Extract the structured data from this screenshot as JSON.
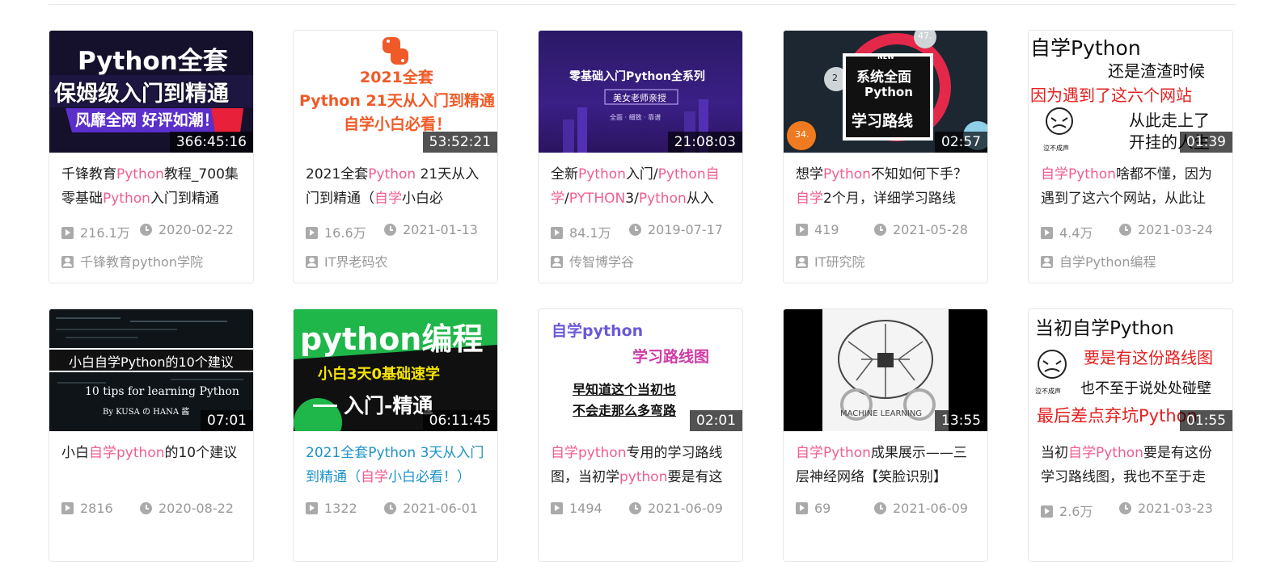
{
  "cards": [
    {
      "thumb": {
        "lines": [
          "Python全套",
          "保姆级入门到精通",
          "风靡全网  好评如潮！"
        ]
      },
      "duration": "366:45:16",
      "title": [
        {
          "t": "千锋教育"
        },
        {
          "t": "Python",
          "hl": true
        },
        {
          "t": "教程_700集零基础"
        },
        {
          "t": "Python",
          "hl": true
        },
        {
          "t": "入门到精通"
        }
      ],
      "views": "216.1万",
      "date": "2020-02-22",
      "author": "千锋教育python学院"
    },
    {
      "thumb": {
        "lines": [
          "2021全套",
          "Python 21天从入门到精通",
          "自学小白必看！"
        ]
      },
      "duration": "53:52:21",
      "title": [
        {
          "t": "2021全套"
        },
        {
          "t": "Python",
          "hl": true
        },
        {
          "t": " 21天从入门到精通（"
        },
        {
          "t": "自学",
          "hl": true
        },
        {
          "t": "小白必"
        }
      ],
      "views": "16.6万",
      "date": "2021-01-13",
      "author": "IT界老码农"
    },
    {
      "thumb": {
        "lines": [
          "零基础入门Python全系列",
          "美女老师亲授",
          "全面  ·  细致  ·  靠谱"
        ]
      },
      "duration": "21:08:03",
      "title": [
        {
          "t": "全新"
        },
        {
          "t": "Python",
          "hl": true
        },
        {
          "t": "入门/"
        },
        {
          "t": "Python自学",
          "hl": true
        },
        {
          "t": "/"
        },
        {
          "t": "PYTHON",
          "hl": true
        },
        {
          "t": "3/"
        },
        {
          "t": "Python",
          "hl": true
        },
        {
          "t": "从入"
        }
      ],
      "views": "84.1万",
      "date": "2019-07-17",
      "author": "传智博学谷"
    },
    {
      "thumb": {
        "lines": [
          "NEW",
          "系统全面",
          "Python",
          "学习路线",
          "47.",
          "2",
          "34."
        ]
      },
      "duration": "02:57",
      "title": [
        {
          "t": "想学"
        },
        {
          "t": "Python",
          "hl": true
        },
        {
          "t": "不知如何下手？"
        },
        {
          "t": "自学",
          "hl": true
        },
        {
          "t": "2个月，详细学习路线"
        }
      ],
      "views": "419",
      "date": "2021-05-28",
      "author": "IT研究院"
    },
    {
      "thumb": {
        "lines": [
          "自学Python",
          "还是渣渣时候",
          "因为遇到了这六个网站",
          "从此走上了",
          "开挂的人生",
          "泣不成声"
        ]
      },
      "duration": "01:39",
      "title": [
        {
          "t": "自学Python",
          "hl": true
        },
        {
          "t": "啥都不懂，因为遇到了这六个网站，从此让"
        }
      ],
      "views": "4.4万",
      "date": "2021-03-24",
      "author": "自学Python编程"
    },
    {
      "thumb": {
        "lines": [
          "小白自学Python的10个建议",
          "10 tips for learning Python",
          "By KUSA の HANA 酱"
        ]
      },
      "duration": "07:01",
      "title": [
        {
          "t": "小白"
        },
        {
          "t": "自学python",
          "hl": true
        },
        {
          "t": "的10个建议"
        }
      ],
      "views": "2816",
      "date": "2020-08-22",
      "author": ""
    },
    {
      "thumb": {
        "lines": [
          "python编程",
          "小白3天0基础速学",
          "入门-精通"
        ]
      },
      "duration": "06:11:45",
      "blueTitle": true,
      "title": [
        {
          "t": "2021全套Python 3天从入门到精通（"
        },
        {
          "t": "自学",
          "hl": true
        },
        {
          "t": "小白必看！）"
        }
      ],
      "views": "1322",
      "date": "2021-06-01",
      "author": ""
    },
    {
      "thumb": {
        "lines": [
          "自学python",
          "学习路线图",
          "早知道这个当初也",
          "不会走那么多弯路"
        ]
      },
      "duration": "02:01",
      "title": [
        {
          "t": "自学python",
          "hl": true
        },
        {
          "t": "专用的学习路线图，当初学"
        },
        {
          "t": "python",
          "hl": true
        },
        {
          "t": "要是有这"
        }
      ],
      "views": "1494",
      "date": "2021-06-09",
      "author": ""
    },
    {
      "thumb": {
        "lines": [
          "MACHINE LEARNING"
        ]
      },
      "duration": "13:55",
      "title": [
        {
          "t": "自学Python",
          "hl": true
        },
        {
          "t": "成果展示——三层神经网络【笑脸识别】"
        }
      ],
      "views": "69",
      "date": "2021-06-09",
      "author": ""
    },
    {
      "thumb": {
        "lines": [
          "当初自学Python",
          "要是有这份路线图",
          "也不至于说处处碰壁",
          "最后差点弃坑Python",
          "泣不成声"
        ]
      },
      "duration": "01:55",
      "title": [
        {
          "t": "当初"
        },
        {
          "t": "自学Python",
          "hl": true
        },
        {
          "t": "要是有这份学习路线图，我也不至于走"
        }
      ],
      "views": "2.6万",
      "date": "2021-03-23",
      "author": ""
    }
  ]
}
